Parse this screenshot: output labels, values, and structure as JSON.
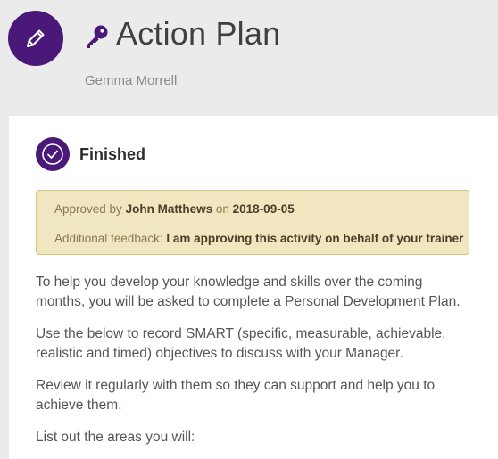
{
  "header": {
    "title": "Action Plan",
    "user_name": "Gemma Morrell",
    "edit_icon": "pencil-icon",
    "title_icon": "key-icon"
  },
  "status": {
    "label": "Finished",
    "icon": "check-circle-icon"
  },
  "approval": {
    "approved_by_prefix": "Approved by",
    "approver": "John Matthews",
    "on_label": "on",
    "date": "2018-09-05",
    "feedback_label": "Additional feedback:",
    "feedback": "I am approving this activity on behalf of your trainer"
  },
  "body": {
    "paragraphs": [
      "To help you develop your knowledge and skills over the coming months, you will be asked to complete a Personal Development Plan.",
      "Use the below to record SMART (specific, measurable, achievable, realistic and timed) objectives to discuss with your Manager.",
      "Review it regularly with them so they can support and help you to achieve them.",
      "List out the areas you will:"
    ]
  },
  "colors": {
    "accent": "#4a1878",
    "background": "#ebebeb",
    "feedback_bg": "#f0e6c0",
    "feedback_border": "#d9c27e"
  }
}
